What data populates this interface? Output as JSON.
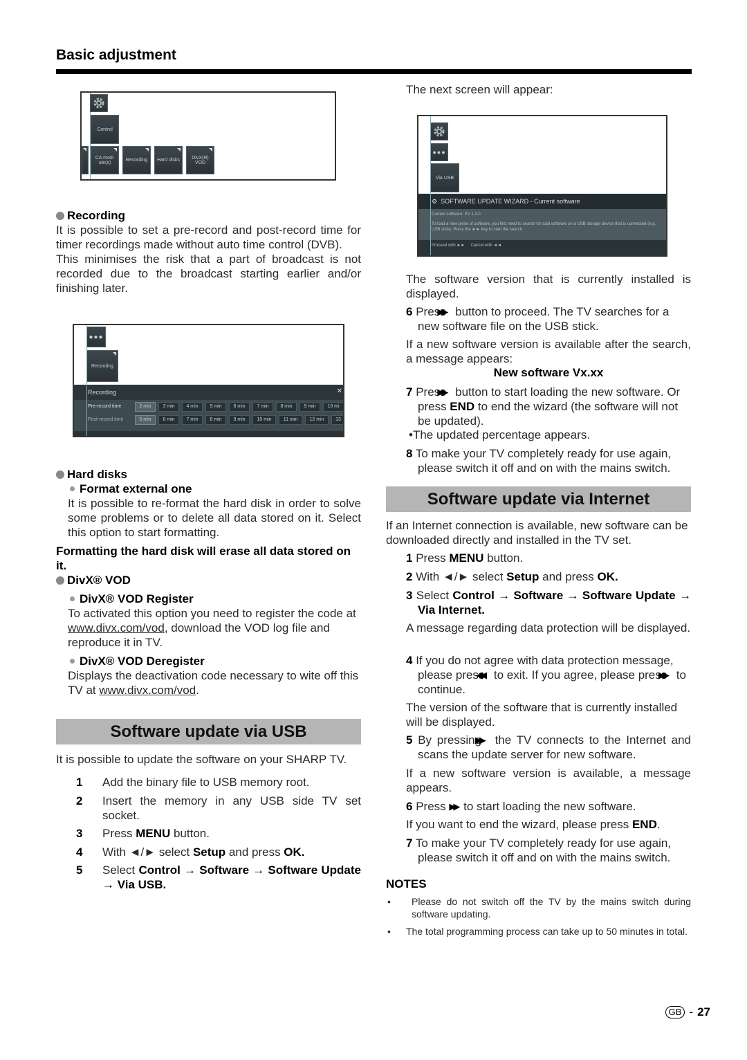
{
  "header": {
    "section_title": "Basic adjustment"
  },
  "screenshot_control_menu": {
    "top_icon": "gear-icon",
    "control_tile": "Control",
    "tiles": [
      "CA mod-\nule(s)",
      "Recording",
      "Hard disks",
      "DivX(R)\nVOD"
    ]
  },
  "recording": {
    "title": "Recording",
    "paragraph1": "It is possible to set a pre-record and post-record time for timer recordings made without auto time control (DVB).",
    "paragraph2": "This minimises the risk that a part of broadcast is not recorded due to the broadcast starting earlier and/or finishing later."
  },
  "screenshot_recording": {
    "top_icon": "more-icon",
    "tile": "Recording",
    "panel_title": "Recording",
    "close_icon": "close-icon",
    "pre_label": "Pre-record time",
    "pre_values": [
      "2 min",
      "3 min",
      "4 min",
      "5 min",
      "6 min",
      "7 min",
      "8 min",
      "9 min",
      "10 mi"
    ],
    "pre_selected": "2 min",
    "post_label": "Post-record time",
    "post_values": [
      "5 min",
      "6 min",
      "7 min",
      "8 min",
      "9 min",
      "10 min",
      "11 min",
      "12 min",
      "13"
    ],
    "post_selected": "5 min"
  },
  "hard_disks": {
    "title": "Hard disks",
    "sub_title": "Format external one",
    "paragraph": "It is possible to re-format the hard disk in order to solve some problems or to delete all data stored on it. Select this option to start formatting.",
    "warning": "Formatting the hard disk will erase all data stored on it."
  },
  "divx": {
    "title": "DivX® VOD",
    "register_title": "DivX® VOD Register",
    "register_text_1": "To activated this option you need to register the code at ",
    "register_link": "www.divx.com/vod",
    "register_text_2": ", download the VOD log file and reproduce it in TV.",
    "deregister_title": "DivX® VOD Deregister",
    "deregister_text_1": "Displays the deactivation code necessary to wite off this TV at ",
    "deregister_link": "www.divx.com/vod",
    "deregister_text_2": "."
  },
  "usb_update": {
    "title": "Software update via USB",
    "intro": "It is possible to update the software on your SHARP TV.",
    "steps": [
      {
        "num": "1",
        "text": "Add the binary file to USB memory root."
      },
      {
        "num": "2",
        "text": "Insert the memory in any USB side TV set socket."
      },
      {
        "num": "3",
        "pre": "Press ",
        "bold": "MENU",
        "post": " button."
      },
      {
        "num": "4",
        "pre": "With ◄/► select ",
        "bold": "Setup",
        "mid": " and press ",
        "bold2": "OK."
      },
      {
        "num": "5",
        "pre": "Select ",
        "bold": "Control → Software → Software Update → Via USB."
      }
    ]
  },
  "right_top": {
    "next_screen": "The next screen will appear:"
  },
  "screenshot_wizard": {
    "icons": [
      "gear-icon",
      "more-icon"
    ],
    "tile": "Via USB",
    "title": "SOFTWARE UPDATE WIZARD - Current software",
    "current_software": "Current software:   PV 1.2.0",
    "description": "To load a new piece of software, you first need to search for said software on a USB storage device that is connected (e.g. USB stick). Press the ►► key to start the search.",
    "footer": "Proceed with ►►     Cancel with ◄◄"
  },
  "usb_continued": {
    "installed_text": "The software version that is currently installed is displayed.",
    "step6_num": "6",
    "step6_pre": "Press",
    "step6_post": "button to proceed. The TV searches for a new software file on the USB stick.",
    "available_text": "If a new software version is available after the search, a message appears:",
    "message": "New software Vx.xx",
    "step7_num": "7",
    "step7_pre": "Press",
    "step7_mid": "button to start loading the new software. Or press ",
    "step7_bold": "END",
    "step7_post": " to end the wizard (the  software will not be updated).",
    "percentage": "•The updated percentage appears.",
    "step8_num": "8",
    "step8_text": "To make your TV completely ready for use again, please switch it off and on with the mains switch."
  },
  "internet_update": {
    "title": "Software update via Internet",
    "intro": "If an Internet connection is available, new software can be downloaded directly and installed in the TV set.",
    "step1": {
      "num": "1",
      "pre": "Press ",
      "bold": "MENU",
      "post": " button."
    },
    "step2": {
      "num": "2",
      "pre": "With ◄/► select ",
      "bold": "Setup",
      "mid": " and press ",
      "bold2": "OK."
    },
    "step3": {
      "num": "3",
      "pre": "Select ",
      "bold": "Control → Software → Software Update → Via Internet."
    },
    "data_protection": "A message regarding data protection will be displayed.",
    "step4": {
      "num": "4",
      "text1": "If you do not agree with data protection message, please press ",
      "rew": "◄◄",
      "text2": " to exit. If you agree, please press ",
      "text3": " to continue."
    },
    "version_text": "The version of the software that is currently installed will be displayed.",
    "step5": {
      "num": "5",
      "pre": "By pressing ",
      "post": " the TV connects to the Internet and scans the update server for new software."
    },
    "available_text": "If a new software version is available, a message appears.",
    "step6": {
      "num": "6",
      "pre": "Press ",
      "post": " to start loading the new software."
    },
    "end_text_pre": "If you want to end the wizard, please press ",
    "end_text_bold": "END",
    "end_text_post": ".",
    "step7": {
      "num": "7",
      "text": "To make your TV completely ready for use again, please switch it off and on with the mains switch."
    }
  },
  "notes": {
    "title": "NOTES",
    "items": [
      "Please do not switch off the TV by the mains switch during software updating.",
      "The total programming process can take up to 50 minutes in total."
    ]
  },
  "footer": {
    "region": "GB",
    "separator": "-",
    "page_number": "27"
  }
}
